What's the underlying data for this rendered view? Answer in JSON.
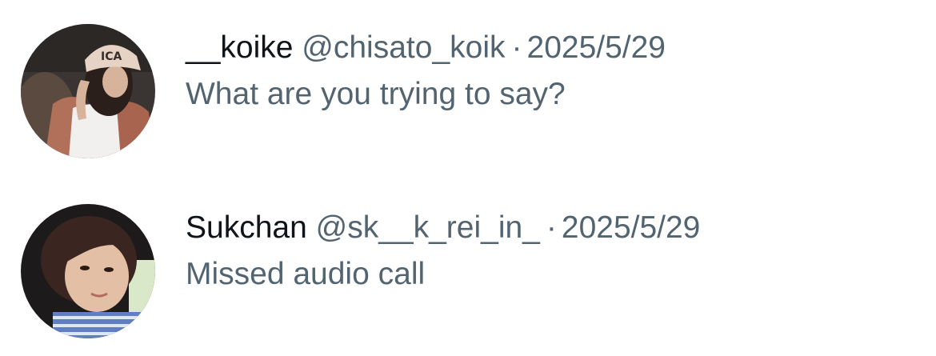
{
  "conversations": [
    {
      "display_name": "__koike",
      "handle": "@chisato_koik",
      "separator": "·",
      "date": "2025/5/29",
      "message": "What are you trying to say?",
      "avatar_icon": "user-avatar-photo"
    },
    {
      "display_name": "Sukchan",
      "handle": "@sk__k_rei_in_",
      "separator": "·",
      "date": "2025/5/29",
      "message": "Missed audio call",
      "avatar_icon": "user-avatar-photo"
    }
  ],
  "colors": {
    "name_text": "#0f1419",
    "secondary_text": "#536471",
    "background": "#ffffff"
  }
}
